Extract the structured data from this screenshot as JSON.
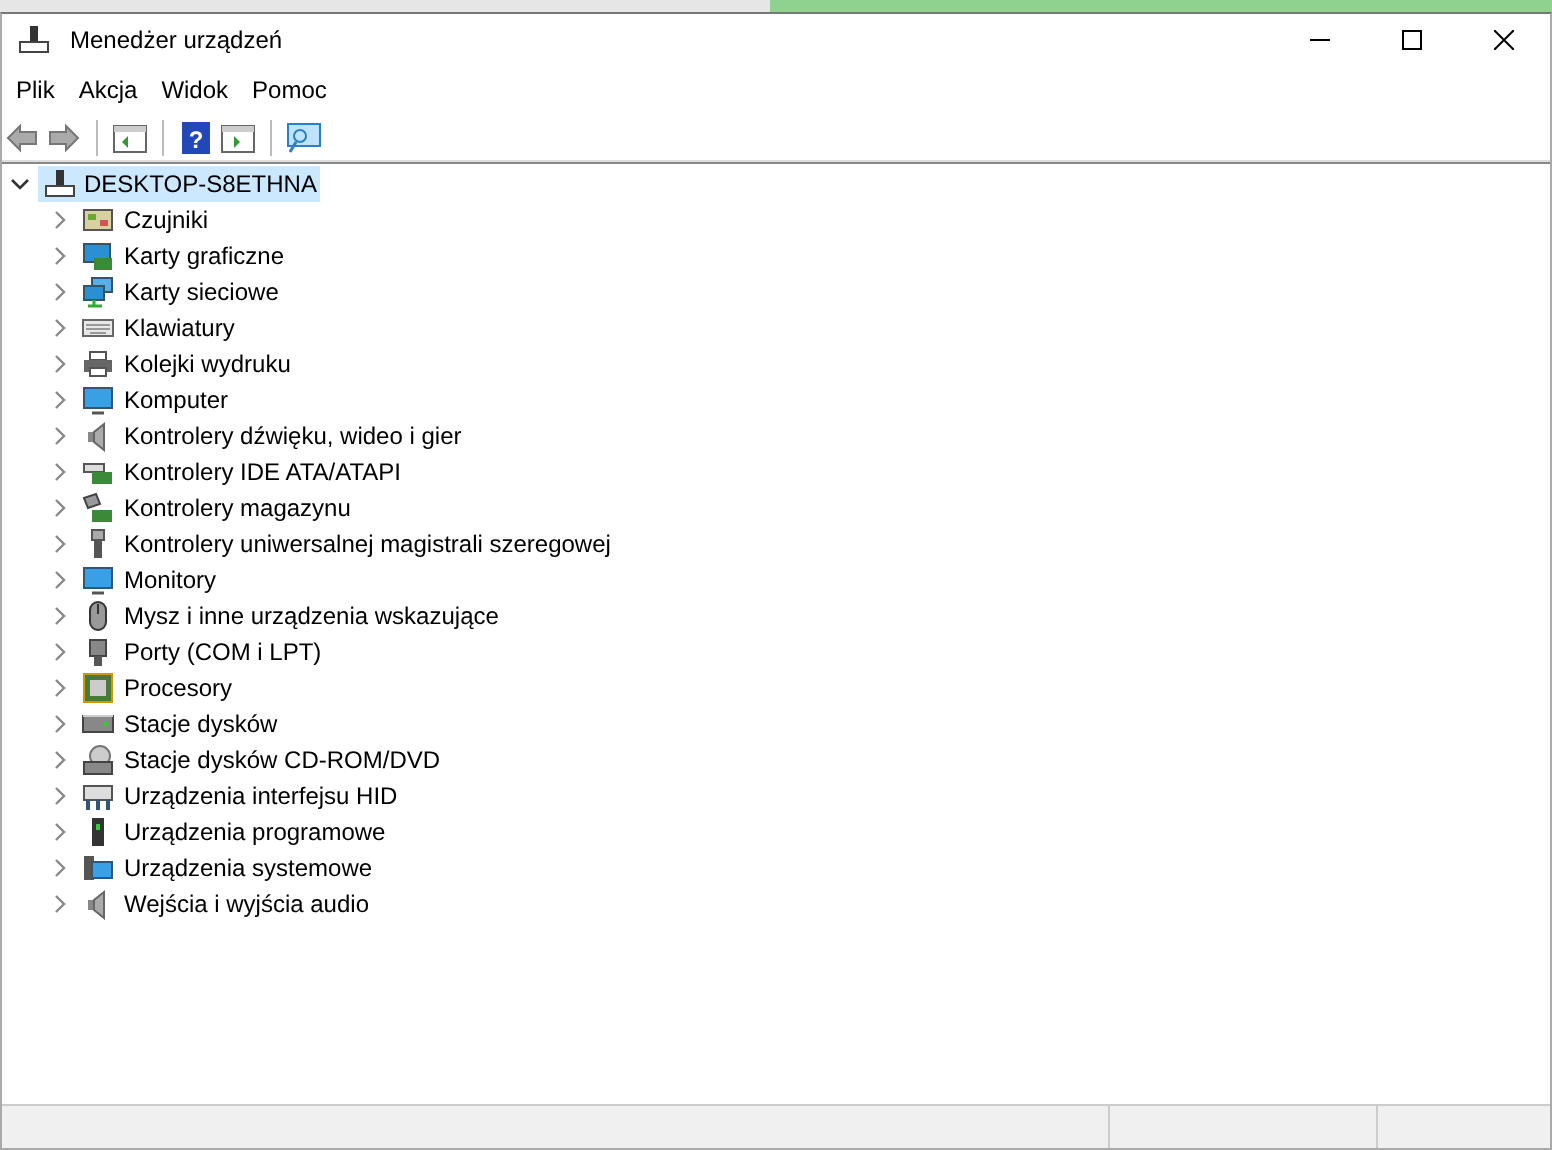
{
  "window": {
    "title": "Menedżer urządzeń"
  },
  "menu": [
    "Plik",
    "Akcja",
    "Widok",
    "Pomoc"
  ],
  "toolbar": {
    "help_glyph": "?"
  },
  "tree": {
    "label": "DESKTOP-S8ETHNA",
    "expanded": true,
    "selected": true,
    "children": [
      {
        "label": "Czujniki",
        "expanded": false
      },
      {
        "label": "Karty graficzne",
        "expanded": false
      },
      {
        "label": "Karty sieciowe",
        "expanded": false
      },
      {
        "label": "Klawiatury",
        "expanded": false
      },
      {
        "label": "Kolejki wydruku",
        "expanded": false
      },
      {
        "label": "Komputer",
        "expanded": false
      },
      {
        "label": "Kontrolery dźwięku, wideo i gier",
        "expanded": false
      },
      {
        "label": "Kontrolery IDE ATA/ATAPI",
        "expanded": false
      },
      {
        "label": "Kontrolery magazynu",
        "expanded": false
      },
      {
        "label": "Kontrolery uniwersalnej magistrali szeregowej",
        "expanded": false
      },
      {
        "label": "Monitory",
        "expanded": false
      },
      {
        "label": "Mysz i inne urządzenia wskazujące",
        "expanded": false
      },
      {
        "label": "Porty (COM i LPT)",
        "expanded": false
      },
      {
        "label": "Procesory",
        "expanded": false
      },
      {
        "label": "Stacje dysków",
        "expanded": false
      },
      {
        "label": "Stacje dysków CD-ROM/DVD",
        "expanded": false
      },
      {
        "label": "Urządzenia interfejsu HID",
        "expanded": false
      },
      {
        "label": "Urządzenia programowe",
        "expanded": false
      },
      {
        "label": "Urządzenia systemowe",
        "expanded": false
      },
      {
        "label": "Wejścia i wyjścia audio",
        "expanded": false
      }
    ]
  }
}
